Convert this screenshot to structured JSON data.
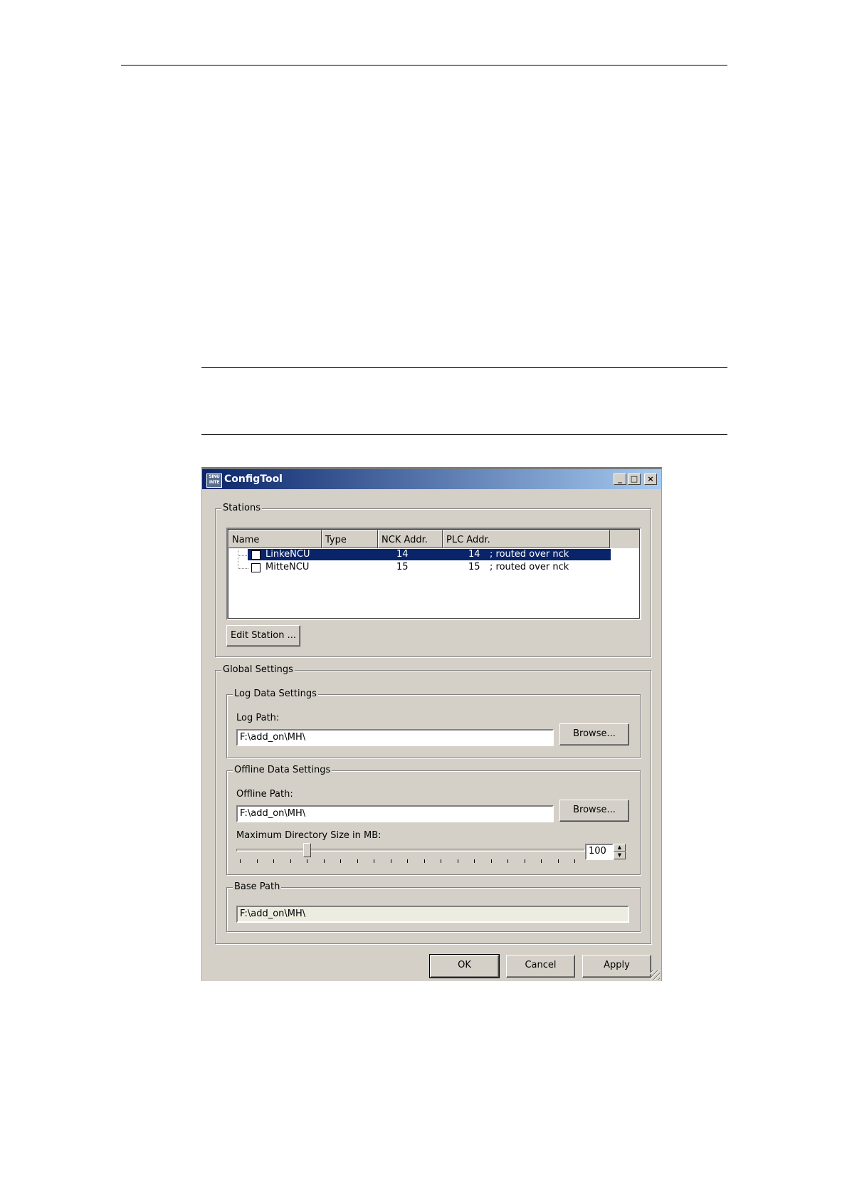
{
  "window": {
    "logo_text": "SINU INTE",
    "title": "ConfigTool",
    "controls": {
      "minimize": "_",
      "maximize": "□",
      "close": "×"
    }
  },
  "stations": {
    "group_label": "Stations",
    "columns": [
      "Name",
      "Type",
      "NCK Addr.",
      "PLC Addr."
    ],
    "rows": [
      {
        "name": "LinkeNCU",
        "type": "",
        "nck": "14",
        "plc": "14",
        "comment": "; routed over nck",
        "selected": true
      },
      {
        "name": "MitteNCU",
        "type": "",
        "nck": "15",
        "plc": "15",
        "comment": "; routed over nck",
        "selected": false
      }
    ],
    "edit_button": "Edit Station ..."
  },
  "global": {
    "group_label": "Global Settings",
    "log": {
      "group_label": "Log Data Settings",
      "path_label": "Log Path:",
      "path_value": "F:\\add_on\\MH\\",
      "browse": "Browse..."
    },
    "offline": {
      "group_label": "Offline Data Settings",
      "path_label": "Offline Path:",
      "path_value": "F:\\add_on\\MH\\",
      "browse": "Browse...",
      "size_label": "Maximum Directory Size in MB:",
      "size_value": "100",
      "slider_fraction": 0.2
    },
    "base": {
      "group_label": "Base Path",
      "path_value": "F:\\add_on\\MH\\"
    }
  },
  "buttons": {
    "ok": "OK",
    "cancel": "Cancel",
    "apply": "Apply"
  }
}
